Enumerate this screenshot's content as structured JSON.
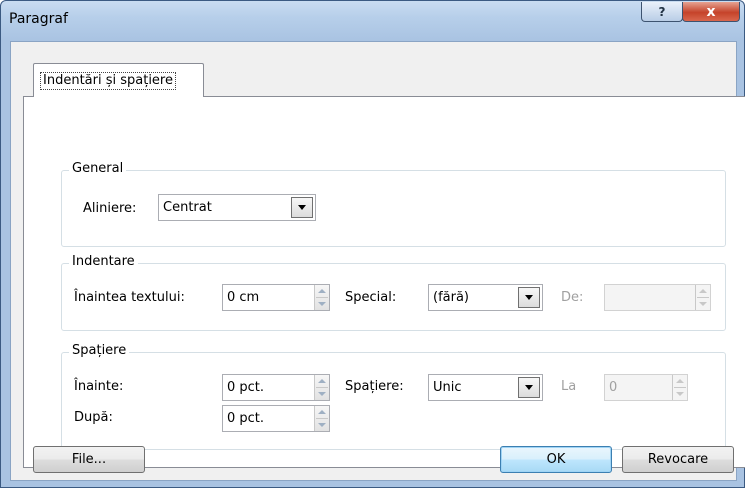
{
  "window": {
    "title": "Paragraf",
    "help_label": "?",
    "close_label": "x"
  },
  "tab": {
    "label": "Indentări și spațiere"
  },
  "general": {
    "title": "General",
    "alignment_label": "Aliniere:",
    "alignment_value": "Centrat"
  },
  "indentation": {
    "title": "Indentare",
    "before_text_label": "Înaintea textului:",
    "before_text_value": "0 cm",
    "special_label": "Special:",
    "special_value": "(fără)",
    "by_label": "De:",
    "by_value": ""
  },
  "spacing": {
    "title": "Spațiere",
    "before_label": "Înainte:",
    "before_value": "0 pct.",
    "after_label": "După:",
    "after_value": "0 pct.",
    "line_spacing_label": "Spațiere:",
    "line_spacing_value": "Unic",
    "at_label": "La",
    "at_value": "0"
  },
  "buttons": {
    "tabs": "File...",
    "ok": "OK",
    "cancel": "Revocare"
  }
}
